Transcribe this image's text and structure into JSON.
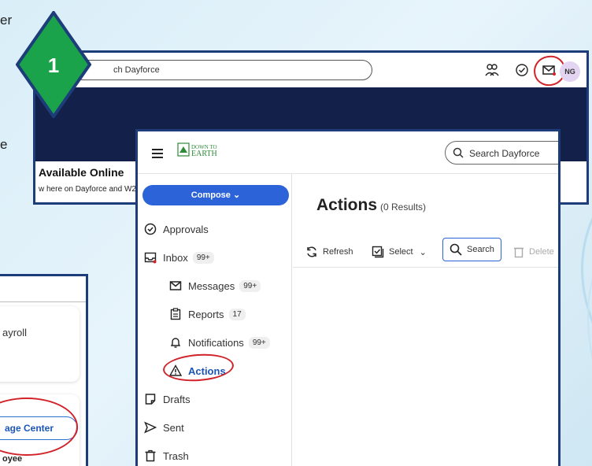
{
  "background": {
    "text_er": "er",
    "text_e": "e"
  },
  "badge": {
    "number": "1",
    "color": "#1aa34a",
    "border": "#1c3d7a"
  },
  "panel1": {
    "search_placeholder": "ch Dayforce",
    "avatar_initials": "NG",
    "banner_title": "Available Online",
    "banner_sub": "w here on Dayforce and W2's",
    "icons": [
      "people-icon",
      "check-circle-icon",
      "mail-icon"
    ]
  },
  "panel3": {
    "payroll_text": "ayroll",
    "message_center_btn": "age Center",
    "employee_text": "oyee"
  },
  "panel2": {
    "logo_line1": "DOWN TO",
    "logo_line2": "EARTH",
    "search_placeholder": "Search Dayforce",
    "compose_label": "Compose",
    "nav": {
      "approvals": "Approvals",
      "inbox": "Inbox",
      "inbox_count": "99+",
      "messages": "Messages",
      "messages_count": "99+",
      "reports": "Reports",
      "reports_count": "17",
      "notifications": "Notifications",
      "notifications_count": "99+",
      "actions": "Actions",
      "drafts": "Drafts",
      "sent": "Sent",
      "trash": "Trash"
    },
    "title": "Actions",
    "result_count": "(0 Results)",
    "toolbar": {
      "refresh": "Refresh",
      "select": "Select",
      "search": "Search",
      "delete": "Delete"
    }
  },
  "colors": {
    "accent": "#2c63d9",
    "annotation_red": "#d1232a",
    "frame": "#1c3d7a",
    "navy_banner": "#13204a"
  }
}
